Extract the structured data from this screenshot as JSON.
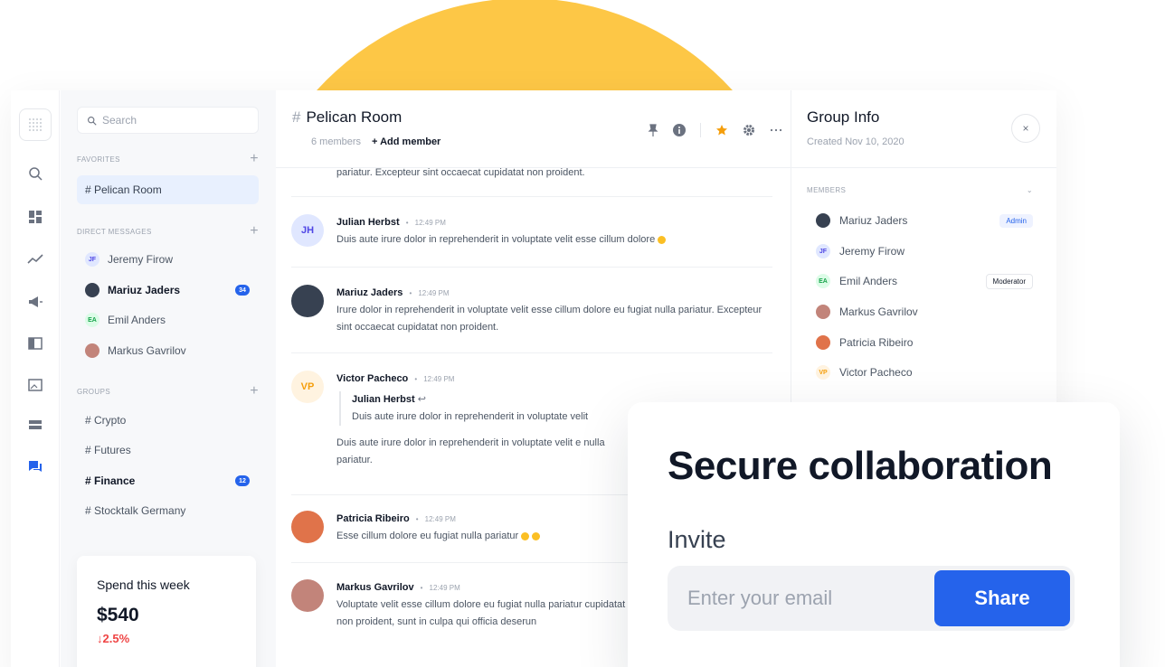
{
  "colors": {
    "accent": "#2563EB",
    "sun": "#FDC746",
    "danger": "#EF4444",
    "star": "#F59E0B"
  },
  "rail": {
    "icons": [
      "grid-icon",
      "search-icon",
      "dashboard-icon",
      "trend-icon",
      "megaphone-icon",
      "layout-icon",
      "image-icon",
      "rows-icon",
      "chat-icon"
    ]
  },
  "sidebar": {
    "search_placeholder": "Search",
    "favorites_label": "FAVORITES",
    "favorites": [
      {
        "label": "# Pelican Room"
      }
    ],
    "dm_label": "DIRECT MESSAGES",
    "dms": [
      {
        "label": "Jeremy Firow",
        "initials": "JF"
      },
      {
        "label": "Mariuz Jaders",
        "badge": "34"
      },
      {
        "label": "Emil Anders",
        "initials": "EA"
      },
      {
        "label": "Markus Gavrilov"
      }
    ],
    "groups_label": "GROUPS",
    "groups": [
      {
        "label": "# Crypto"
      },
      {
        "label": "# Futures"
      },
      {
        "label": "# Finance",
        "badge": "12"
      },
      {
        "label": "# Stocktalk Germany"
      }
    ],
    "plus": "+"
  },
  "spend": {
    "title": "Spend this week",
    "value": "$540",
    "delta": "↓2.5%"
  },
  "chat": {
    "hash": "#",
    "title": "Pelican Room",
    "members": "6 members",
    "add": "+  Add member",
    "top_text": "pariatur. Excepteur sint occaecat cupidatat non proident.",
    "messages": [
      {
        "name": "Julian Herbst",
        "time": "12:49 PM",
        "initials": "JH",
        "text": "Duis aute irure dolor in reprehenderit in voluptate velit esse cillum dolore"
      },
      {
        "name": "Mariuz Jaders",
        "time": "12:49 PM",
        "text": "Irure dolor in reprehenderit in voluptate velit esse cillum dolore eu fugiat nulla pariatur. Excepteur sint occaecat cupidatat non proident."
      },
      {
        "name": "Victor Pacheco",
        "time": "12:49 PM",
        "initials": "VP",
        "quote_name": "Julian Herbst",
        "quote_text": "Duis aute irure dolor in reprehenderit in voluptate velit",
        "text": "Duis aute irure dolor in reprehenderit in voluptate velit e nulla pariatur."
      },
      {
        "name": "Patricia Ribeiro",
        "time": "12:49 PM",
        "text": "Esse cillum dolore eu fugiat nulla pariatur"
      },
      {
        "name": "Markus Gavrilov",
        "time": "12:49 PM",
        "text": "Voluptate velit esse cillum dolore eu fugiat nulla pariatur cupidatat non proident, sunt in culpa qui officia deserun"
      }
    ],
    "dot": "•"
  },
  "info": {
    "title": "Group Info",
    "created": "Created Nov 10, 2020",
    "close": "×",
    "members_label": "MEMBERS",
    "members": [
      {
        "name": "Mariuz Jaders",
        "role": "Admin"
      },
      {
        "name": "Jeremy Firow",
        "initials": "JF"
      },
      {
        "name": "Emil Anders",
        "initials": "EA",
        "role": "Moderator"
      },
      {
        "name": "Markus Gavrilov"
      },
      {
        "name": "Patricia Ribeiro"
      },
      {
        "name": "Victor Pacheco",
        "initials": "VP"
      }
    ]
  },
  "card": {
    "heading": "Secure collaboration",
    "invite_label": "Invite",
    "email_placeholder": "Enter your email",
    "share_label": "Share"
  }
}
